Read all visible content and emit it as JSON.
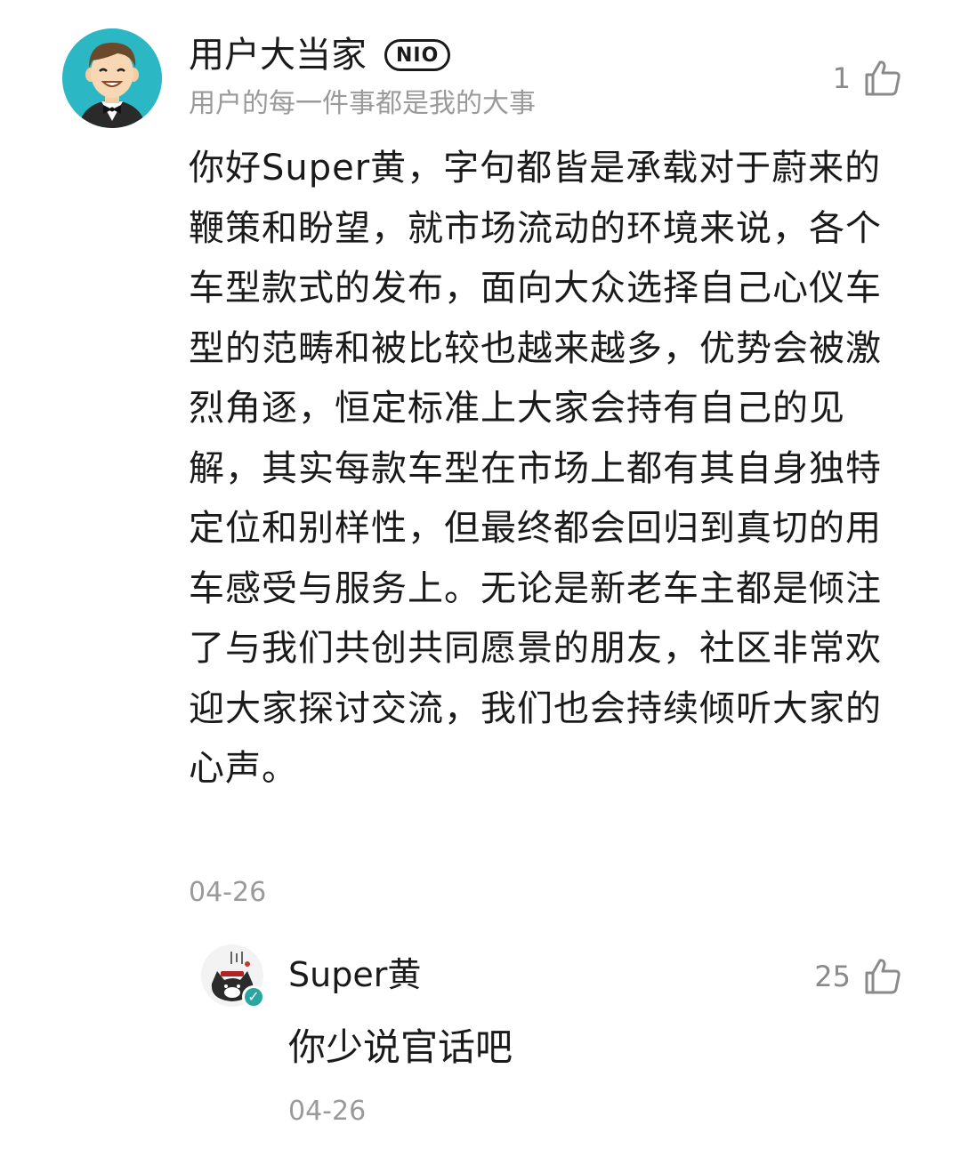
{
  "comment": {
    "author_name": "用户大当家",
    "badge": "NIO",
    "author_bio": "用户的每一件事都是我的大事",
    "like_count": "1",
    "body": "你好Super黄，字句都皆是承载对于蔚来的鞭策和盼望，就市场流动的环境来说，各个车型款式的发布，面向大众选择自己心仪车型的范畴和被比较也越来越多，优势会被激烈角逐，恒定标准上大家会持有自己的见解，其实每款车型在市场上都有其自身独特定位和别样性，但最终都会回归到真切的用车感受与服务上。无论是新老车主都是倾注了与我们共创共同愿景的朋友，社区非常欢迎大家探讨交流，我们也会持续倾听大家的心声。",
    "date": "04-26",
    "avatar_icon": "butler-avatar-icon",
    "like_icon": "thumbs-up-icon"
  },
  "reply": {
    "author_name": "Super黄",
    "like_count": "25",
    "body": "你少说官话吧",
    "date": "04-26",
    "avatar_icon": "cat-avatar-icon",
    "verified_icon": "verified-check-icon",
    "like_icon": "thumbs-up-icon"
  },
  "colors": {
    "text": "#1a1a1a",
    "muted": "#9a9a9a",
    "avatar_bg": "#2bb7c4",
    "verified": "#2aa6a2"
  }
}
